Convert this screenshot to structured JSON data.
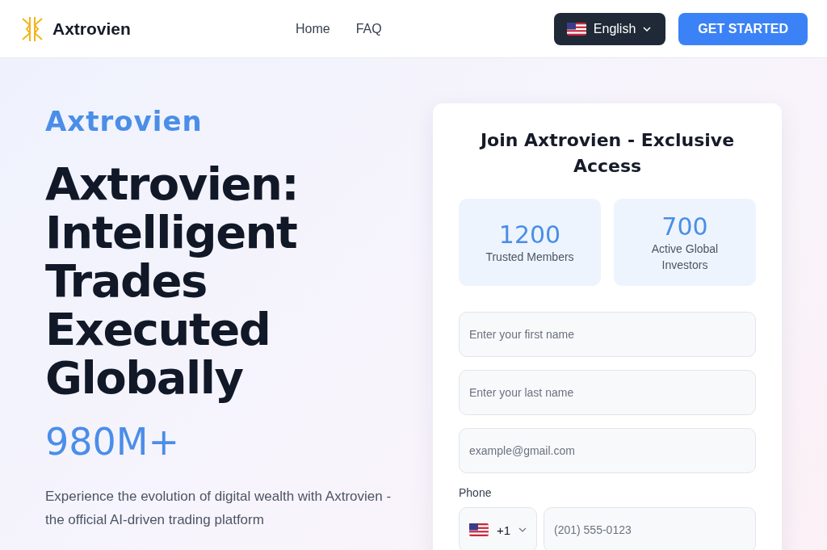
{
  "header": {
    "brand": "Axtrovien",
    "nav": [
      {
        "label": "Home"
      },
      {
        "label": "FAQ"
      }
    ],
    "language": {
      "label": "English"
    },
    "cta": "GET STARTED"
  },
  "hero": {
    "eyebrow": "Axtrovien",
    "headline": "Axtrovien: Intelligent Trades Executed Globally",
    "stat": "980M+",
    "description": "Experience the evolution of digital wealth with Axtrovien - the official AI-driven trading platform"
  },
  "form": {
    "title": "Join Axtrovien - Exclusive Access",
    "stats": [
      {
        "value": "1200",
        "label": "Trusted Members"
      },
      {
        "value": "700",
        "label": "Active Global Investors"
      }
    ],
    "fields": [
      {
        "placeholder": "Enter your first name"
      },
      {
        "placeholder": "Enter your last name"
      },
      {
        "placeholder": "example@gmail.com"
      }
    ],
    "phone": {
      "label": "Phone",
      "code": "+1",
      "placeholder": "(201) 555-0123"
    }
  }
}
